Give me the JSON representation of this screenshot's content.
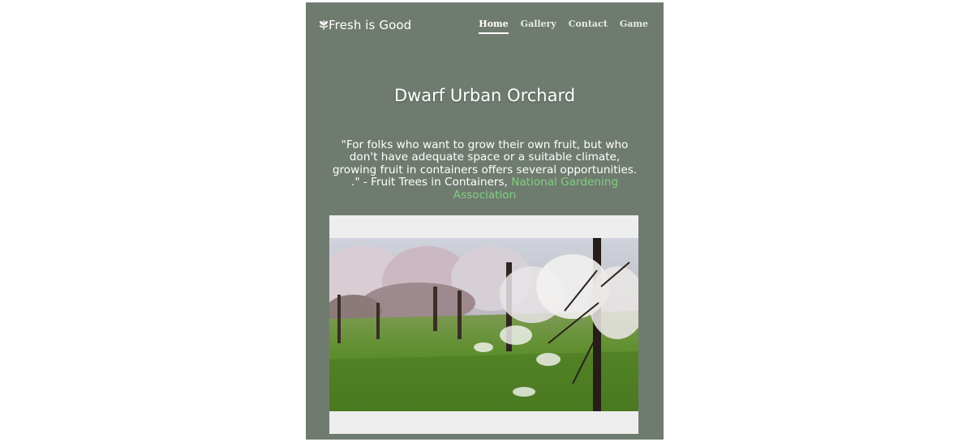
{
  "header": {
    "brand": "Fresh is Good",
    "brand_icon": "leaf-icon",
    "nav": [
      {
        "label": "Home",
        "active": true
      },
      {
        "label": "Gallery",
        "active": false
      },
      {
        "label": "Contact",
        "active": false
      },
      {
        "label": "Game",
        "active": false
      }
    ]
  },
  "main": {
    "title": "Dwarf Urban Orchard",
    "quote_text": "\"For folks who want to grow their own fruit, but who don't have adequate space or a suitable climate, growing fruit in containers offers several opportunities. .\" - Fruit Trees in Containers, ",
    "quote_link": "National Gardening Association"
  },
  "colors": {
    "page_bg": "#707b70",
    "link": "#7ed27e",
    "media_bg": "#eeeeee"
  }
}
